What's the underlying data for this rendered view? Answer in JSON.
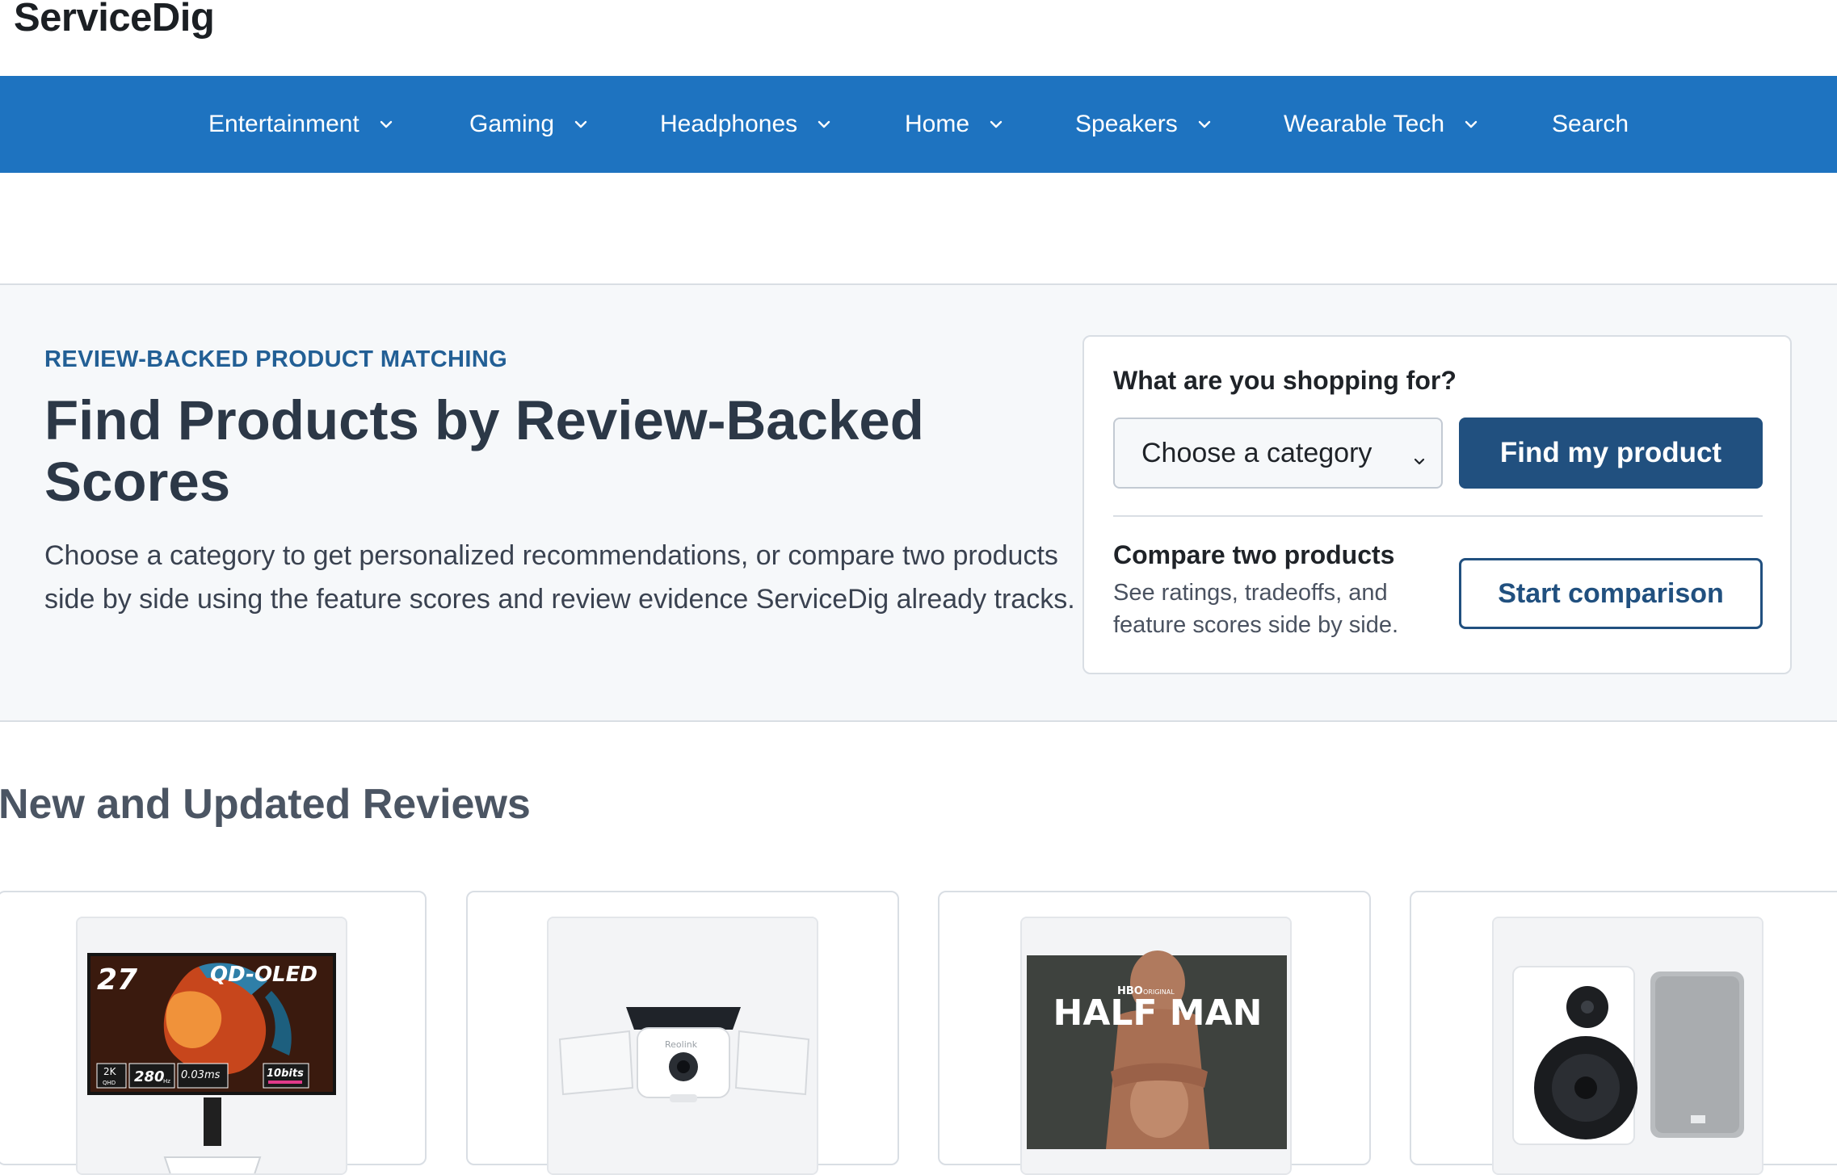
{
  "brand": "ServiceDig",
  "nav": {
    "items": [
      {
        "label": "Entertainment",
        "has_dropdown": true
      },
      {
        "label": "Gaming",
        "has_dropdown": true
      },
      {
        "label": "Headphones",
        "has_dropdown": true
      },
      {
        "label": "Home",
        "has_dropdown": true
      },
      {
        "label": "Speakers",
        "has_dropdown": true
      },
      {
        "label": "Wearable Tech",
        "has_dropdown": true
      },
      {
        "label": "Search",
        "has_dropdown": false
      }
    ]
  },
  "hero": {
    "eyebrow": "REVIEW-BACKED PRODUCT MATCHING",
    "title": "Find Products by Review-Backed Scores",
    "description": "Choose a category to get personalized recommendations, or compare two products side by side using the feature scores and review evidence ServiceDig already tracks."
  },
  "finder": {
    "question": "What are you shopping for?",
    "select_value": "Choose a category",
    "find_button": "Find my product",
    "compare_title": "Compare two products",
    "compare_desc": "See ratings, tradeoffs, and feature scores side by side.",
    "compare_button": "Start comparison"
  },
  "reviews": {
    "title": "New and Updated Reviews",
    "cards": [
      {
        "image": "qd-oled-monitor",
        "image_text": {
          "size": "27",
          "panel": "QD-OLED",
          "res": "2K",
          "res_sub": "QHD",
          "hz": "280",
          "hz_unit": "Hz",
          "ms": "0.03ms",
          "bits": "10bits"
        }
      },
      {
        "image": "floodlight-camera",
        "image_text": {
          "brand": "Reolink"
        }
      },
      {
        "image": "half-man-poster",
        "image_text": {
          "network": "HBO",
          "tag": "ORIGINAL",
          "title": "HALF MAN"
        }
      },
      {
        "image": "bookshelf-speakers"
      }
    ]
  },
  "colors": {
    "nav_bg": "#1e73c0",
    "primary_button": "#21507f",
    "eyebrow": "#225f95",
    "hero_bg": "#f6f8fa"
  }
}
